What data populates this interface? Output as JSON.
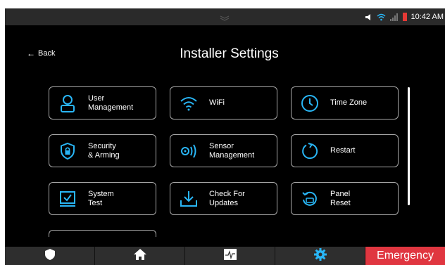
{
  "status_bar": {
    "time": "10:42 AM",
    "icons": [
      "chevron-down-icon",
      "volume-icon",
      "wifi-icon",
      "signal-icon",
      "battery-low-icon"
    ]
  },
  "header": {
    "back_label": "Back",
    "title": "Installer Settings"
  },
  "tiles": [
    {
      "label": "User\nManagement",
      "icon": "user-icon"
    },
    {
      "label": "WiFi",
      "icon": "wifi-icon"
    },
    {
      "label": "Time Zone",
      "icon": "clock-icon"
    },
    {
      "label": "Security\n& Arming",
      "icon": "shield-lock-icon"
    },
    {
      "label": "Sensor\nManagement",
      "icon": "sensor-icon"
    },
    {
      "label": "Restart",
      "icon": "restart-icon"
    },
    {
      "label": "System\nTest",
      "icon": "system-test-icon"
    },
    {
      "label": "Check For\nUpdates",
      "icon": "download-icon"
    },
    {
      "label": "Panel\nReset",
      "icon": "panel-reset-icon"
    }
  ],
  "bottom_nav": {
    "items": [
      "shield-icon",
      "home-icon",
      "activity-icon",
      "gear-icon"
    ],
    "emergency_label": "Emergency"
  },
  "colors": {
    "accent": "#29b6f6",
    "emergency": "#e03640",
    "battery": "#e53935"
  }
}
